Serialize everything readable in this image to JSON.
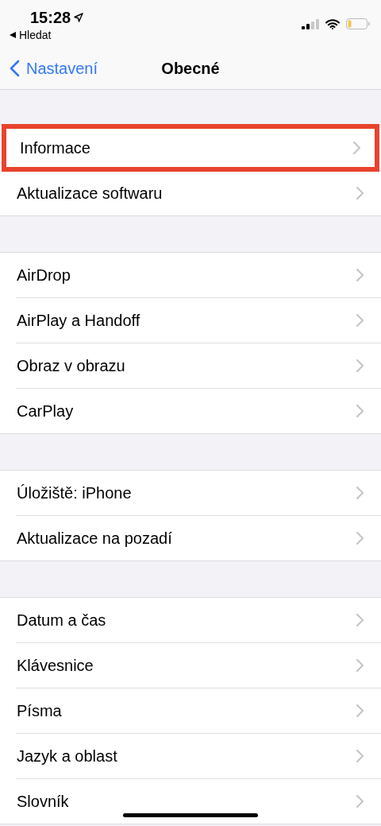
{
  "status_bar": {
    "time": "15:28",
    "back_app": "Hledat"
  },
  "nav": {
    "back": "Nastavení",
    "title": "Obecné"
  },
  "groups": [
    {
      "items": [
        {
          "label": "Informace",
          "highlighted": true
        },
        {
          "label": "Aktualizace softwaru",
          "highlighted": false
        }
      ]
    },
    {
      "items": [
        {
          "label": "AirDrop",
          "highlighted": false
        },
        {
          "label": "AirPlay a Handoff",
          "highlighted": false
        },
        {
          "label": "Obraz v obrazu",
          "highlighted": false
        },
        {
          "label": "CarPlay",
          "highlighted": false
        }
      ]
    },
    {
      "items": [
        {
          "label": "Úložiště: iPhone",
          "highlighted": false
        },
        {
          "label": "Aktualizace na pozadí",
          "highlighted": false
        }
      ]
    },
    {
      "items": [
        {
          "label": "Datum a čas",
          "highlighted": false
        },
        {
          "label": "Klávesnice",
          "highlighted": false
        },
        {
          "label": "Písma",
          "highlighted": false
        },
        {
          "label": "Jazyk a oblast",
          "highlighted": false
        },
        {
          "label": "Slovník",
          "highlighted": false
        }
      ]
    }
  ]
}
